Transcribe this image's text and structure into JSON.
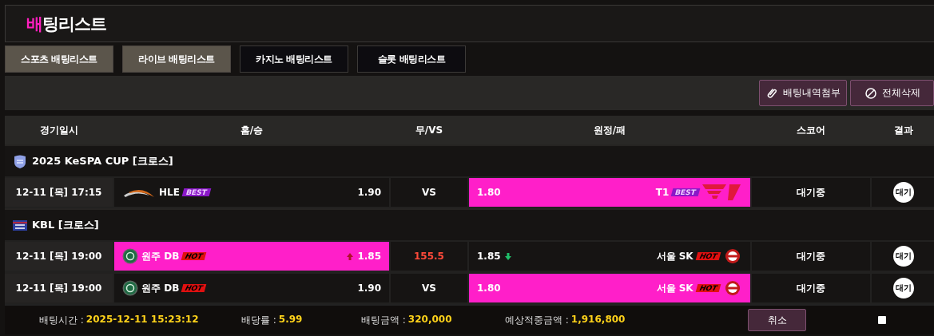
{
  "title": "**배**팅리스트",
  "tabs": [
    {
      "label": "스포츠 배팅리스트",
      "selected": true
    },
    {
      "label": "라이브 배팅리스트",
      "selected": true
    },
    {
      "label": "카지노 배팅리스트",
      "selected": false
    },
    {
      "label": "슬롯 배팅리스트",
      "selected": false
    }
  ],
  "toolbar": [
    {
      "label": "배팅내역첨부"
    },
    {
      "label": "전체삭제"
    }
  ],
  "table": {
    "columns": [
      "경기일시",
      "홈/승",
      "무/VS",
      "원정/패",
      "스코어",
      "결과"
    ],
    "groups": [
      {
        "league": "2025 KeSPA CUP [크로스]",
        "kind": "shield",
        "rows": [
          {
            "date": "12-11 [목] 17:15",
            "home": {
              "name": "HLE",
              "logo": {
                "kind": "swoosh"
              },
              "badge": {
                "kind": "best",
                "text": "BEST"
              },
              "odds": "1.90",
              "selected": false
            },
            "draw": {
              "kind": "vs",
              "text": "VS",
              "selected": false
            },
            "away": {
              "name": "T1",
              "logo": {
                "kind": "stripes"
              },
              "badge": {
                "kind": "best",
                "text": "BEST"
              },
              "odds": "1.80",
              "selected": true
            },
            "score": "대기중",
            "result": "대기"
          }
        ]
      },
      {
        "league": "KBL [크로스]",
        "kind": "flag",
        "rows": [
          {
            "date": "12-11 [목] 19:00",
            "home": {
              "name": "원주 DB",
              "logo": {
                "kind": "green"
              },
              "badge": {
                "kind": "hot",
                "text": "HOT"
              },
              "odds": "1.85",
              "trend": {
                "kind": "up"
              },
              "selected": true
            },
            "draw": {
              "kind": "line",
              "text": "155.5",
              "selected": false
            },
            "away": {
              "name": "서울 SK",
              "logo": {
                "kind": "red"
              },
              "badge": {
                "kind": "hot",
                "text": "HOT"
              },
              "odds": "1.85",
              "trend": {
                "kind": "down"
              },
              "selected": false
            },
            "score": "대기중",
            "result": "대기"
          },
          {
            "date": "12-11 [목] 19:00",
            "home": {
              "name": "원주 DB",
              "logo": {
                "kind": "green"
              },
              "badge": {
                "kind": "hot",
                "text": "HOT"
              },
              "odds": "1.90",
              "selected": false
            },
            "draw": {
              "kind": "vs",
              "text": "VS",
              "selected": false
            },
            "away": {
              "name": "서울 SK",
              "logo": {
                "kind": "red"
              },
              "badge": {
                "kind": "hot",
                "text": "HOT"
              },
              "odds": "1.80",
              "selected": true
            },
            "score": "대기중",
            "result": "대기"
          }
        ]
      }
    ]
  },
  "summary": {
    "items": [
      {
        "label": "배팅시간 :",
        "value": "2025-12-11 15:23:12"
      },
      {
        "label": "배당률 :",
        "value": "5.99"
      },
      {
        "label": "배팅금액 :",
        "value": "320,000"
      },
      {
        "label": "예상적중금액 :",
        "value": "1,916,800"
      }
    ],
    "cancel": "취소",
    "checked": false
  }
}
